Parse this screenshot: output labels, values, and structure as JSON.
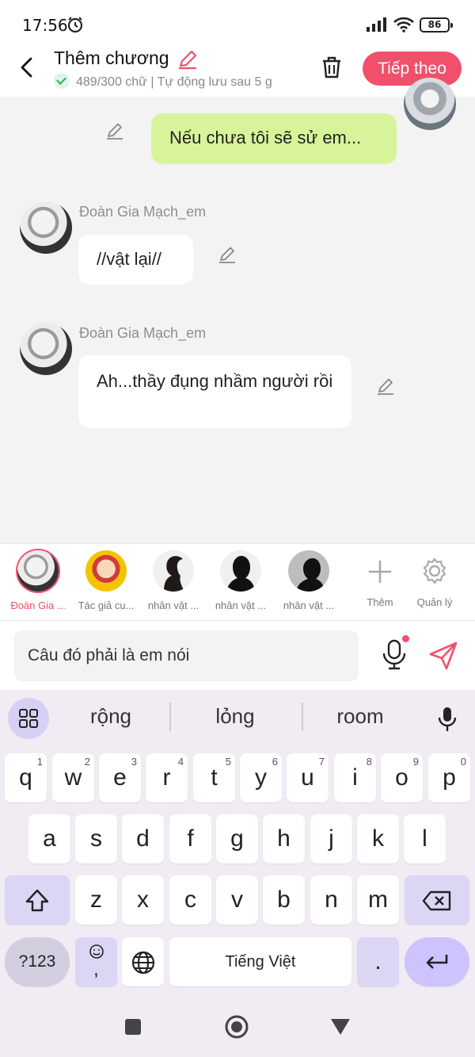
{
  "status": {
    "time": "17:56",
    "battery": "86"
  },
  "header": {
    "title": "Thêm chương",
    "subtitle": "489/300 chữ | Tự động lưu sau 5 g",
    "next_label": "Tiếp theo"
  },
  "messages": [
    {
      "side": "right",
      "text": "Nếu chưa tôi sẽ sử em..."
    },
    {
      "side": "left",
      "sender": "Đoàn Gia Mạch_em",
      "text": "//vật lại//"
    },
    {
      "side": "left",
      "sender": "Đoàn Gia Mạch_em",
      "text": "Ah...thầy đụng nhầm người rồi"
    }
  ],
  "characters": [
    {
      "label": "Đoàn Gia ...",
      "active": true
    },
    {
      "label": "Tác giả cu...",
      "active": false
    },
    {
      "label": "nhân vật ...",
      "active": false
    },
    {
      "label": "nhân vật ...",
      "active": false
    },
    {
      "label": "nhân vật ...",
      "active": false
    }
  ],
  "actions": {
    "add_label": "Thêm",
    "manage_label": "Quản lý"
  },
  "composer": {
    "value": "Câu đó phải là em nói"
  },
  "keyboard": {
    "suggestions": [
      "rộng",
      "lỏng",
      "room"
    ],
    "row1": [
      "q",
      "w",
      "e",
      "r",
      "t",
      "y",
      "u",
      "i",
      "o",
      "p"
    ],
    "row1_hints": [
      "1",
      "2",
      "3",
      "4",
      "5",
      "6",
      "7",
      "8",
      "9",
      "0"
    ],
    "row2": [
      "a",
      "s",
      "d",
      "f",
      "g",
      "h",
      "j",
      "k",
      "l"
    ],
    "row3": [
      "z",
      "x",
      "c",
      "v",
      "b",
      "n",
      "m"
    ],
    "sym_label": "?123",
    "space_label": "Tiếng Việt",
    "period_label": ".",
    "comma_label": ","
  },
  "colors": {
    "accent": "#f0506b",
    "bubble_self": "#d7f49a",
    "keyboard_bg": "#f1ebf4"
  }
}
